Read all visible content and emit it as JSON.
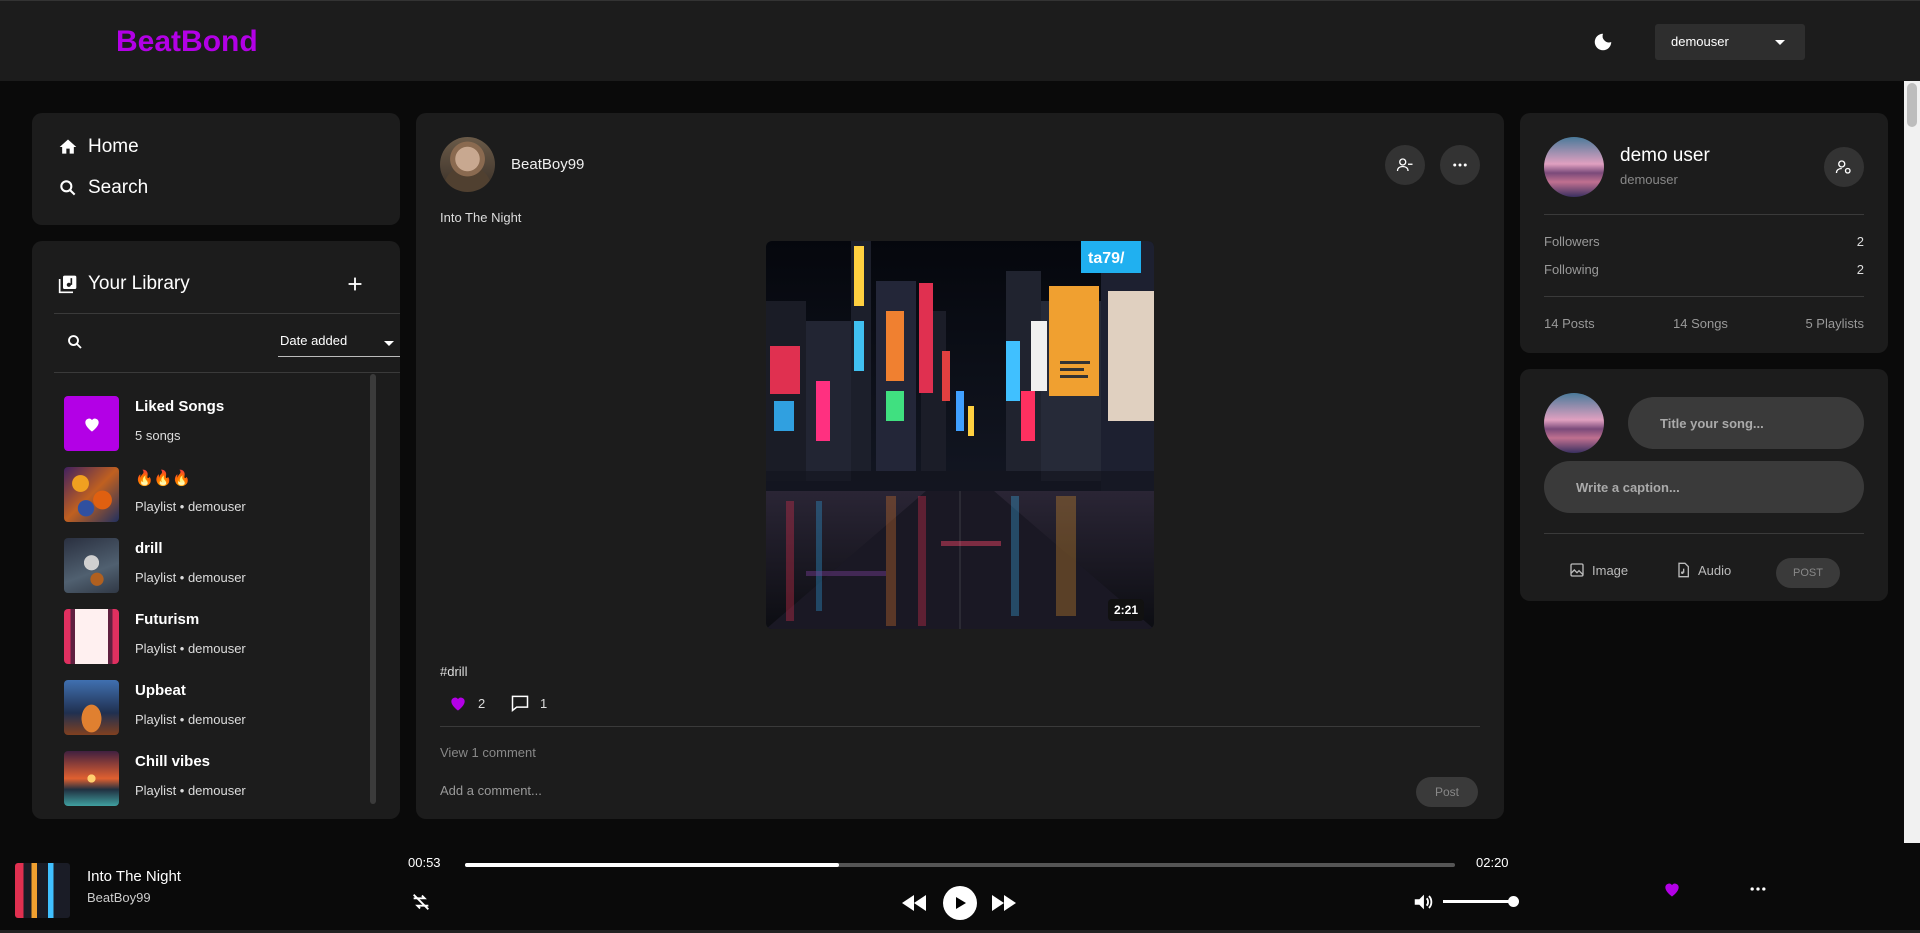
{
  "app": {
    "logo": "BeatBond",
    "brand_color": "#b300e6"
  },
  "header": {
    "theme_icon": "moon-icon",
    "user_select": "demouser"
  },
  "nav": {
    "home": "Home",
    "search": "Search"
  },
  "library": {
    "title": "Your Library",
    "sort_label": "Date added",
    "items": [
      {
        "name": "Liked Songs",
        "sub": "5 songs",
        "icon": "heart-icon"
      },
      {
        "name": "🔥🔥🔥",
        "sub": "Playlist • demouser"
      },
      {
        "name": "drill",
        "sub": "Playlist • demouser"
      },
      {
        "name": "Futurism",
        "sub": "Playlist • demouser"
      },
      {
        "name": "Upbeat",
        "sub": "Playlist • demouser"
      },
      {
        "name": "Chill vibes",
        "sub": "Playlist • demouser"
      }
    ]
  },
  "post": {
    "username": "BeatBoy99",
    "title": "Into The Night",
    "image_sign": "ta79/",
    "duration": "2:21",
    "tag": "#drill",
    "likes": "2",
    "comments": "1",
    "view_comments": "View 1 comment",
    "comment_placeholder": "Add a comment...",
    "post_button": "Post"
  },
  "profile": {
    "name": "demo user",
    "handle": "demouser",
    "followers_label": "Followers",
    "followers": "2",
    "following_label": "Following",
    "following": "2",
    "posts": "14 Posts",
    "songs": "14 Songs",
    "playlists": "5 Playlists"
  },
  "composer": {
    "title_placeholder": "Title your song...",
    "caption_placeholder": "Write a caption...",
    "image_label": "Image",
    "audio_label": "Audio",
    "post_button": "POST"
  },
  "player": {
    "title": "Into The Night",
    "artist": "BeatBoy99",
    "current_time": "00:53",
    "total_time": "02:20",
    "progress": 0.378,
    "volume": 1.0
  }
}
